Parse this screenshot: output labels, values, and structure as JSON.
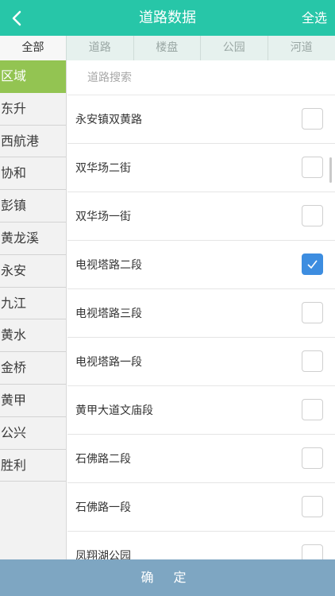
{
  "header": {
    "title": "道路数据",
    "select_all": "全选",
    "back_icon": "chevron-left-icon"
  },
  "tabs": [
    "全部",
    "道路",
    "楼盘",
    "公园",
    "河道"
  ],
  "sidebar": {
    "items": [
      "区域",
      "东升",
      "西航港",
      "协和",
      "彭镇",
      "黄龙溪",
      "永安",
      "九江",
      "黄水",
      "金桥",
      "黄甲",
      "公兴",
      "胜利"
    ]
  },
  "search": {
    "placeholder": "道路搜索"
  },
  "roads": [
    {
      "name": "永安镇双黄路",
      "checked": false
    },
    {
      "name": "双华场二街",
      "checked": false
    },
    {
      "name": "双华场一街",
      "checked": false
    },
    {
      "name": "电视塔路二段",
      "checked": true
    },
    {
      "name": "电视塔路三段",
      "checked": false
    },
    {
      "name": "电视塔路一段",
      "checked": false
    },
    {
      "name": "黄甲大道文庙段",
      "checked": false
    },
    {
      "name": "石佛路二段",
      "checked": false
    },
    {
      "name": "石佛路一段",
      "checked": false
    },
    {
      "name": "凤翔湖公园",
      "checked": false
    }
  ],
  "confirm_label": "确 定",
  "colors": {
    "header": "#27c6a8",
    "active_region": "#93c452",
    "checked": "#3d8de0",
    "confirm_bar": "#7ea6c2"
  }
}
